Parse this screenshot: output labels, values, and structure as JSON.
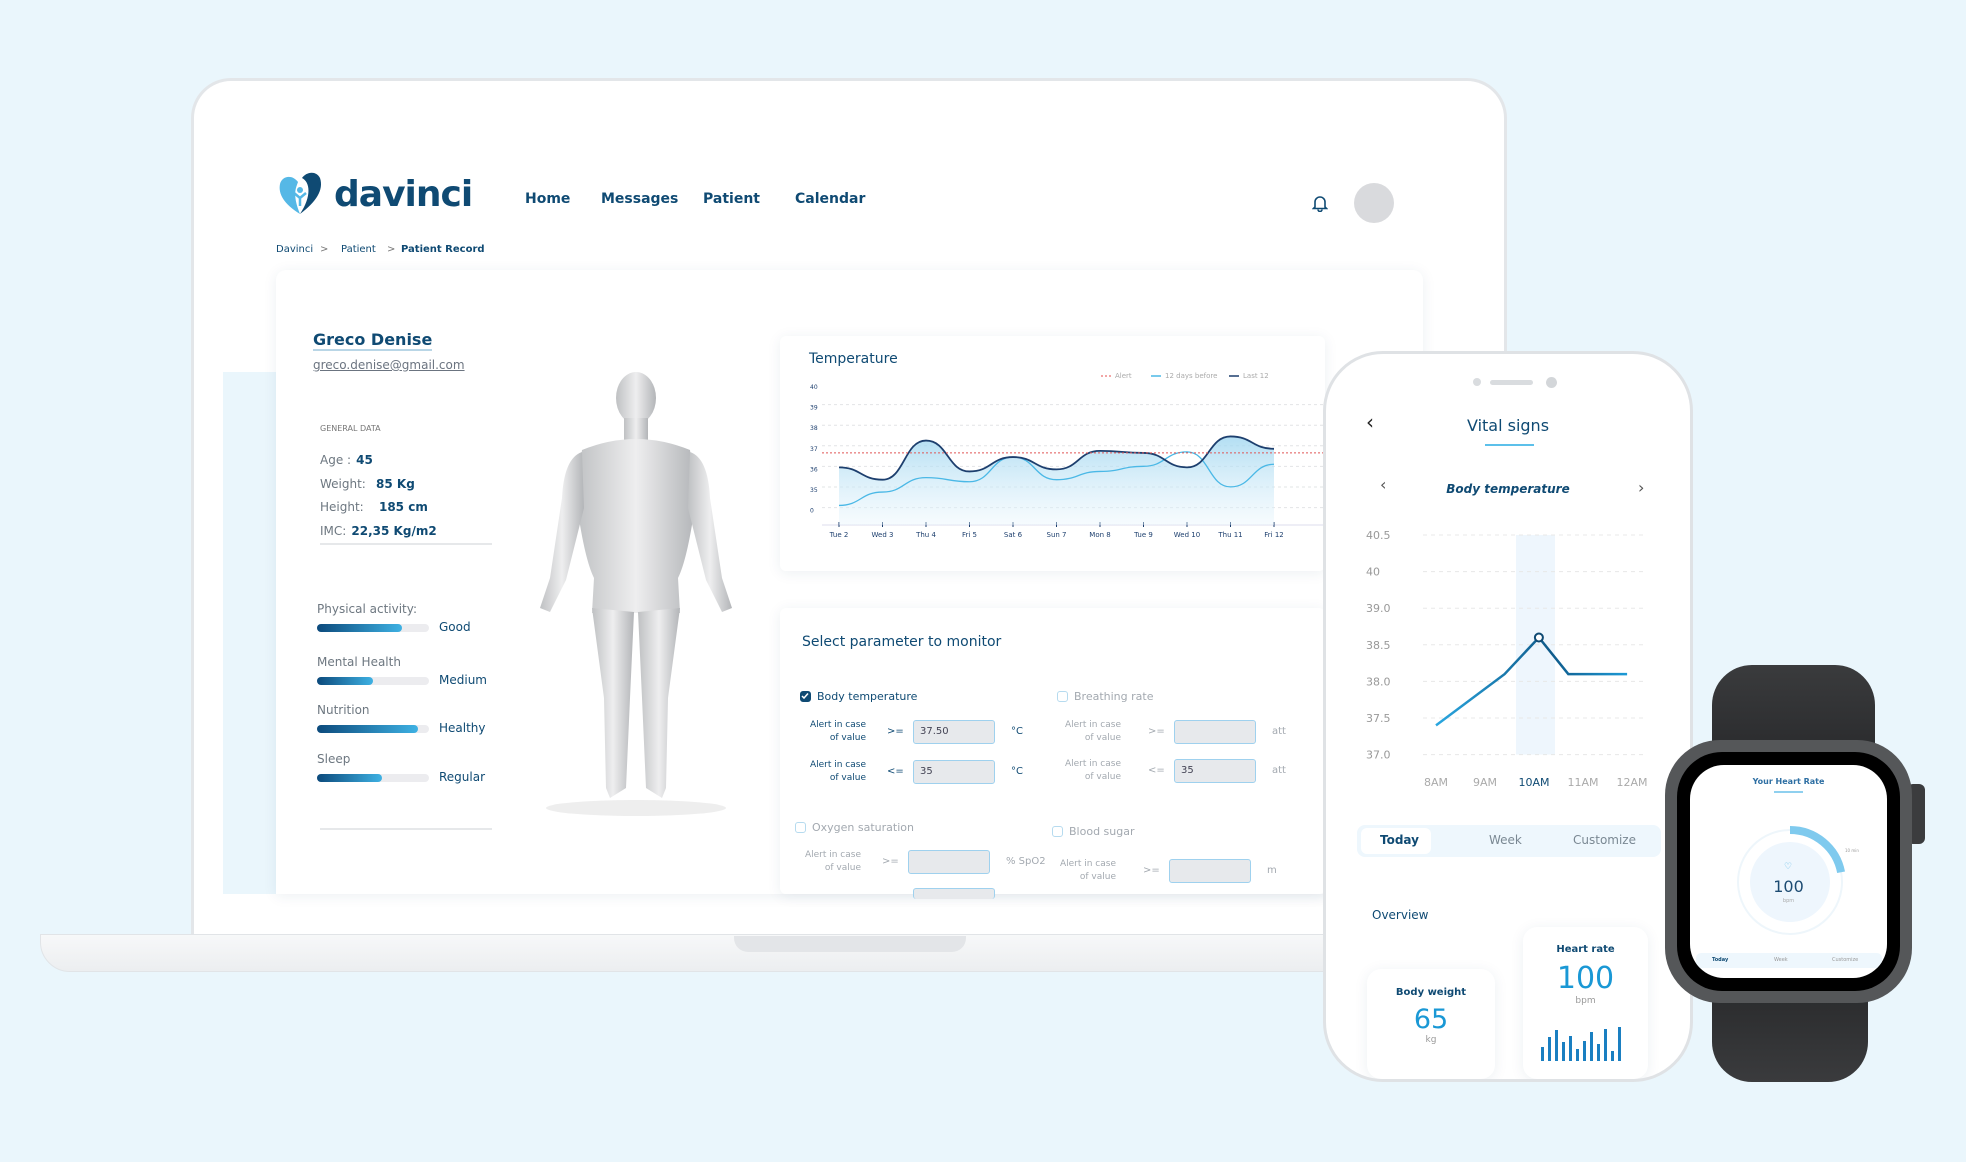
{
  "brand": {
    "name": "davinci",
    "accent": "#0f4a73",
    "light_accent": "#3eb1e3"
  },
  "nav": {
    "items": [
      "Home",
      "Messages",
      "Patient",
      "Calendar"
    ]
  },
  "icons": {
    "bell": "bell-icon",
    "avatar": "avatar"
  },
  "breadcrumb": [
    "Davinci",
    "Patient",
    "Patient Record"
  ],
  "patient": {
    "name": "Greco Denise",
    "email": "greco.denise@gmail.com",
    "general_title": "GENERAL DATA",
    "general": [
      {
        "label": "Age :",
        "value": "45"
      },
      {
        "label": "Weight:",
        "value": "85 Kg"
      },
      {
        "label": "Height:",
        "value": "185 cm"
      },
      {
        "label": "IMC:",
        "value": "22,35 Kg/m2"
      }
    ],
    "wellbeing": [
      {
        "label": "Physical activity:",
        "level": "Good",
        "fill": 0.76
      },
      {
        "label": "Mental Health",
        "level": "Medium",
        "fill": 0.5
      },
      {
        "label": "Nutrition",
        "level": "Healthy",
        "fill": 0.9
      },
      {
        "label": "Sleep",
        "level": "Regular",
        "fill": 0.58
      }
    ]
  },
  "chart_data": [
    {
      "type": "line",
      "title": "Temperature",
      "legend": [
        "Alert",
        "12 days before",
        "Last 12"
      ],
      "categories": [
        "Tue 2",
        "Wed 3",
        "Thu 4",
        "Fri 5",
        "Sat 6",
        "Sun 7",
        "Mon 8",
        "Tue 9",
        "Wed 10",
        "Thu 11",
        "Fri 12"
      ],
      "yticks": [
        "40",
        "39",
        "38",
        "37",
        "36",
        "35",
        "0"
      ],
      "alert": 36.8,
      "series": [
        {
          "name": "12 days before",
          "color": "#4ab8e6",
          "values": [
            34.25,
            34.9,
            35.6,
            35.4,
            36.6,
            35.5,
            35.9,
            36.15,
            36.85,
            35.15,
            36.25
          ]
        },
        {
          "name": "Last 12",
          "color": "#1d3f6e",
          "values": [
            36.1,
            35.5,
            37.4,
            35.9,
            36.6,
            36.0,
            36.9,
            36.8,
            36.1,
            37.6,
            37.0
          ]
        }
      ],
      "grid": true,
      "legend_position": "top-right"
    },
    {
      "type": "line",
      "title": "Body temperature",
      "yticks": [
        "40.5",
        "40",
        "39.0",
        "38.5",
        "38.0",
        "37.5",
        "37.0"
      ],
      "xticks": [
        "8AM",
        "9AM",
        "10AM",
        "11AM",
        "12AM"
      ],
      "selected": "10AM",
      "points": [
        [
          8,
          37.4
        ],
        [
          9.4,
          38.1
        ],
        [
          10.1,
          38.6
        ],
        [
          10.7,
          38.1
        ],
        [
          11.9,
          38.1
        ]
      ],
      "ylim": [
        37.0,
        40.5
      ]
    }
  ],
  "monitor": {
    "title": "Select parameter to monitor",
    "alert_label_1": "Alert in case",
    "alert_label_2": "of value",
    "params": [
      {
        "name": "Body temperature",
        "checked": true,
        "rows": [
          {
            "op": ">=",
            "value": "37.50",
            "unit": "°C"
          },
          {
            "op": "<=",
            "value": "35",
            "unit": "°C"
          }
        ]
      },
      {
        "name": "Breathing rate",
        "checked": false,
        "rows": [
          {
            "op": ">=",
            "value": "",
            "unit": "att"
          },
          {
            "op": "<=",
            "value": "35",
            "unit": "att"
          }
        ]
      },
      {
        "name": "Oxygen saturation",
        "checked": false,
        "rows": [
          {
            "op": ">=",
            "value": "",
            "unit": "% SpO2"
          }
        ]
      },
      {
        "name": "Blood sugar",
        "checked": false,
        "rows": [
          {
            "op": ">=",
            "value": "",
            "unit": "m"
          }
        ]
      }
    ]
  },
  "phone": {
    "title": "Vital signs",
    "metric": "Body temperature",
    "tabs": [
      "Today",
      "Week",
      "Customize"
    ],
    "active_tab": "Today",
    "overview": "Overview",
    "body_weight": {
      "label": "Body weight",
      "value": "65",
      "unit": "kg"
    },
    "heart_rate": {
      "label": "Heart rate",
      "value": "100",
      "unit": "bpm",
      "bars": [
        0.4,
        0.7,
        0.9,
        0.55,
        0.75,
        0.35,
        0.6,
        0.85,
        0.5,
        0.95,
        0.3,
        1.0
      ]
    }
  },
  "watch": {
    "title": "Your Heart Rate",
    "value": "100",
    "unit": "bpm",
    "arc_label": "10 min",
    "arc_fraction": 0.22,
    "tabs": [
      "Today",
      "Week",
      "Customize"
    ]
  }
}
